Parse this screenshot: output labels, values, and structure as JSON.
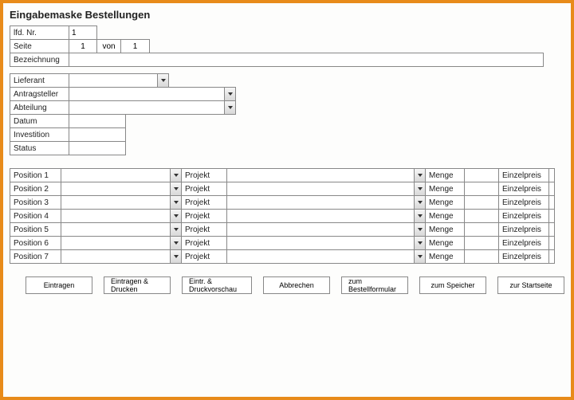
{
  "title": "Eingabemaske Bestellungen",
  "header": {
    "lfd_nr_label": "lfd. Nr.",
    "lfd_nr_value": "1",
    "seite_label": "Seite",
    "seite_current": "1",
    "seite_von": "von",
    "seite_total": "1",
    "bezeichnung_label": "Bezeichnung",
    "bezeichnung_value": ""
  },
  "meta": {
    "lieferant_label": "Lieferant",
    "lieferant_value": "",
    "antragsteller_label": "Antragsteller",
    "antragsteller_value": "",
    "abteilung_label": "Abteilung",
    "abteilung_value": "",
    "datum_label": "Datum",
    "datum_value": "",
    "investition_label": "Investition",
    "investition_value": "",
    "status_label": "Status",
    "status_value": ""
  },
  "pos_labels": {
    "projekt": "Projekt",
    "menge": "Menge",
    "einzelpreis": "Einzelpreis"
  },
  "positions": [
    {
      "label": "Position 1",
      "value": "",
      "projekt": "",
      "menge": "",
      "einzelpreis": ""
    },
    {
      "label": "Position 2",
      "value": "",
      "projekt": "",
      "menge": "",
      "einzelpreis": ""
    },
    {
      "label": "Position 3",
      "value": "",
      "projekt": "",
      "menge": "",
      "einzelpreis": ""
    },
    {
      "label": "Position 4",
      "value": "",
      "projekt": "",
      "menge": "",
      "einzelpreis": ""
    },
    {
      "label": "Position 5",
      "value": "",
      "projekt": "",
      "menge": "",
      "einzelpreis": ""
    },
    {
      "label": "Position 6",
      "value": "",
      "projekt": "",
      "menge": "",
      "einzelpreis": ""
    },
    {
      "label": "Position 7",
      "value": "",
      "projekt": "",
      "menge": "",
      "einzelpreis": ""
    }
  ],
  "buttons": {
    "eintragen": "Eintragen",
    "eintragen_drucken": "Eintragen & Drucken",
    "eintr_druckvorschau": "Eintr. & Druckvorschau",
    "abbrechen": "Abbrechen",
    "zum_bestellformular": "zum Bestellformular",
    "zum_speicher": "zum Speicher",
    "zur_startseite": "zur Startseite"
  }
}
